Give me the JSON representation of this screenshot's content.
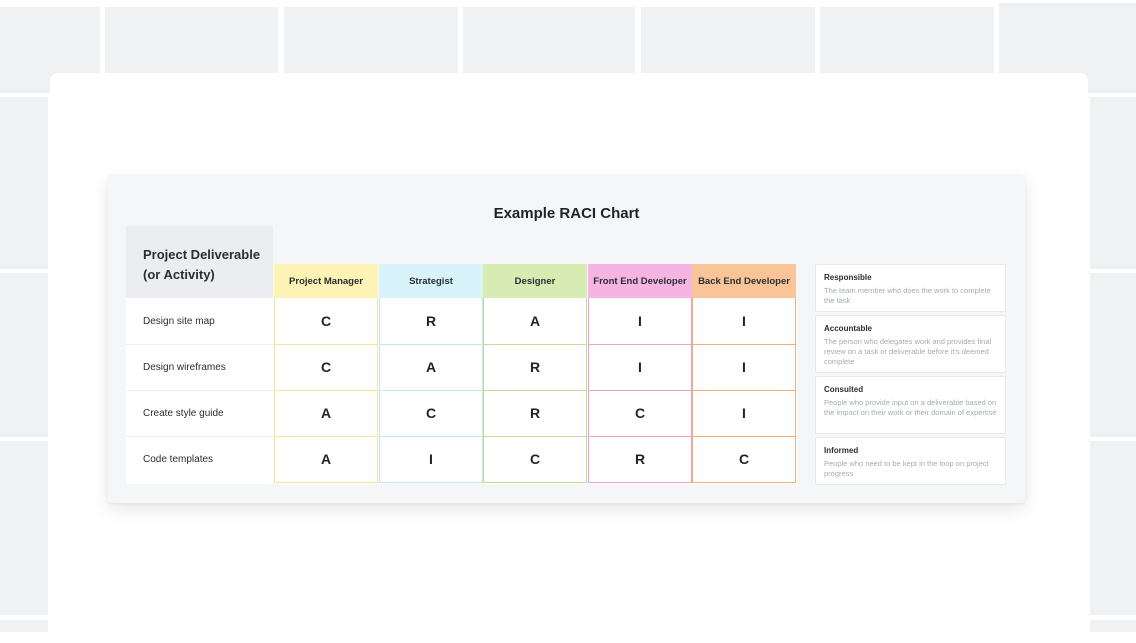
{
  "chart": {
    "title": "Example RACI Chart",
    "deliverable_header": [
      "Project Deliverable",
      "(or Activity)"
    ],
    "roles": [
      {
        "label": "Project Manager",
        "color": "#fdf3b4",
        "line": "#f3e49a"
      },
      {
        "label": "Strategist",
        "color": "#d9f3fa",
        "line": "#bfe6f2"
      },
      {
        "label": "Designer",
        "color": "#d6ecb3",
        "line": "#c2dd94"
      },
      {
        "label": "Front End Developer",
        "color": "#f5b4e2",
        "line": "#ec9fd4"
      },
      {
        "label": "Back End Developer",
        "color": "#f9c498",
        "line": "#f2ae78"
      }
    ],
    "rows": [
      {
        "deliverable": "Design site map",
        "values": [
          "C",
          "R",
          "A",
          "I",
          "I"
        ]
      },
      {
        "deliverable": "Design wireframes",
        "values": [
          "C",
          "A",
          "R",
          "I",
          "I"
        ]
      },
      {
        "deliverable": "Create style guide",
        "values": [
          "A",
          "C",
          "R",
          "C",
          "I"
        ]
      },
      {
        "deliverable": "Code templates",
        "values": [
          "A",
          "I",
          "C",
          "R",
          "C"
        ]
      }
    ]
  },
  "legend": [
    {
      "title": "Responsible",
      "description": "The team member who does the work to complete the task"
    },
    {
      "title": "Accountable",
      "description": "The person who delegates work and provides final review on a task or deliverable before it's deemed complete"
    },
    {
      "title": "Consulted",
      "description": "People who provide input on a deliverable based on the impact on their work or their domain of expertise"
    },
    {
      "title": "Informed",
      "description": "People who need to be kept in the loop on project progress"
    }
  ]
}
